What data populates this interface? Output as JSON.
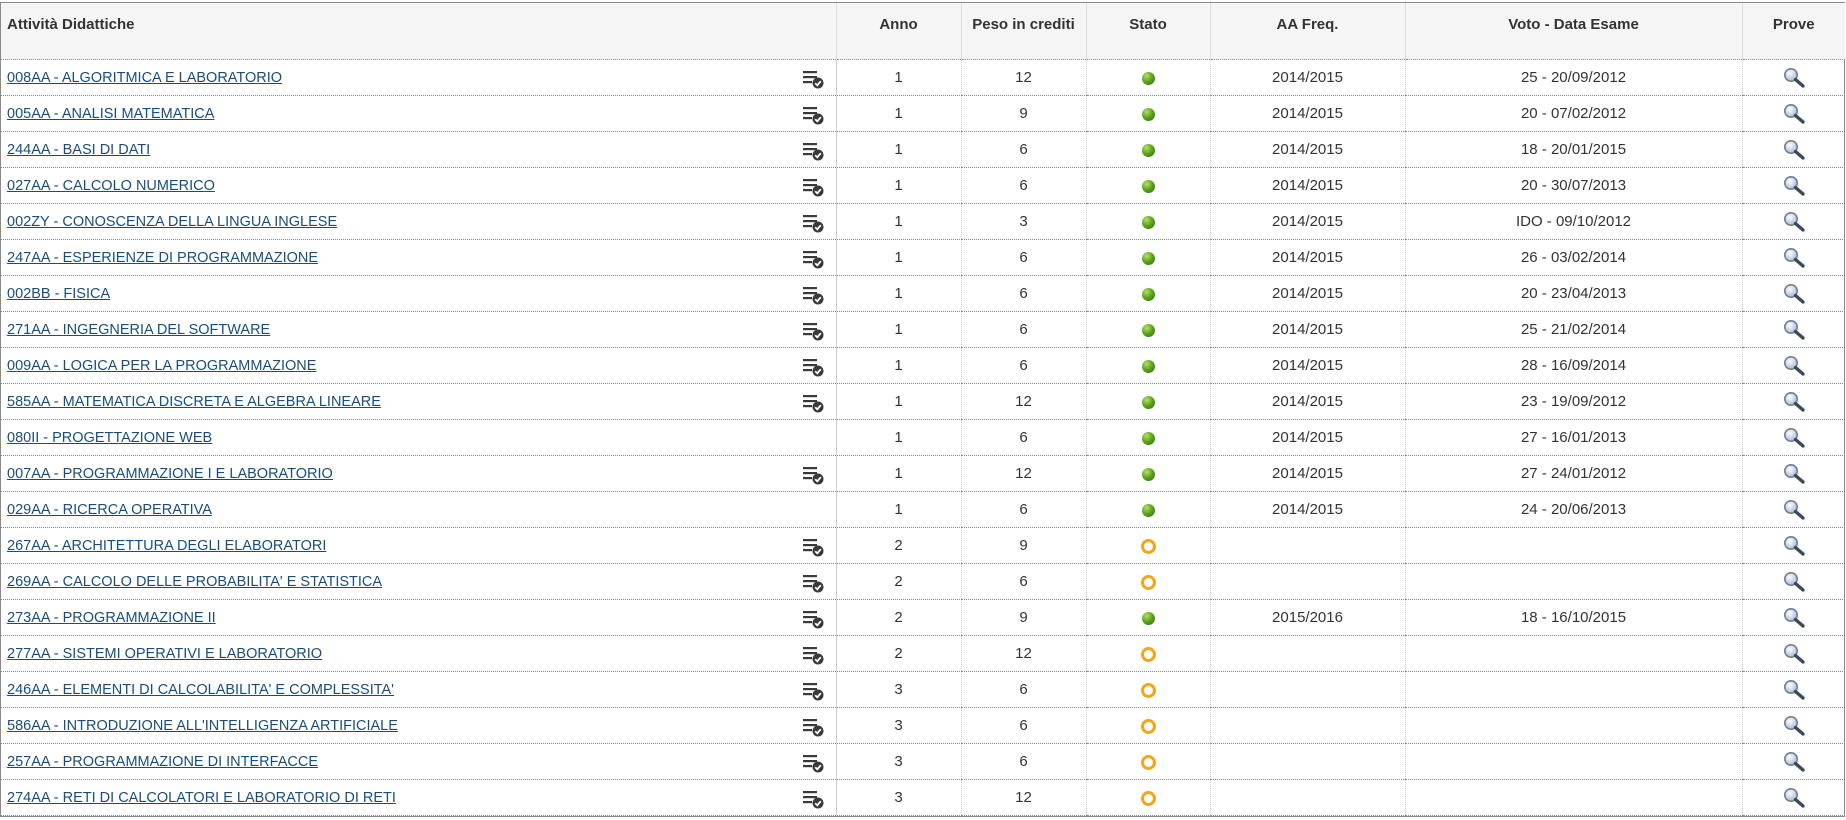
{
  "table": {
    "headers": {
      "activity": "Attività Didattiche",
      "year": "Anno",
      "credits": "Peso in crediti",
      "status": "Stato",
      "aa_freq": "AA Freq.",
      "grade_date": "Voto - Data Esame",
      "tests": "Prove"
    },
    "rows": [
      {
        "activity": "008AA - ALGORITMICA E LABORATORIO",
        "list_icon": true,
        "year": "1",
        "credits": "12",
        "status": "passed",
        "aa_freq": "2014/2015",
        "grade_date": "25 - 20/09/2012"
      },
      {
        "activity": "005AA - ANALISI MATEMATICA",
        "list_icon": true,
        "year": "1",
        "credits": "9",
        "status": "passed",
        "aa_freq": "2014/2015",
        "grade_date": "20 - 07/02/2012"
      },
      {
        "activity": "244AA - BASI DI DATI",
        "list_icon": true,
        "year": "1",
        "credits": "6",
        "status": "passed",
        "aa_freq": "2014/2015",
        "grade_date": "18 - 20/01/2015"
      },
      {
        "activity": "027AA - CALCOLO NUMERICO",
        "list_icon": true,
        "year": "1",
        "credits": "6",
        "status": "passed",
        "aa_freq": "2014/2015",
        "grade_date": "20 - 30/07/2013"
      },
      {
        "activity": "002ZY - CONOSCENZA DELLA LINGUA INGLESE",
        "list_icon": true,
        "year": "1",
        "credits": "3",
        "status": "passed",
        "aa_freq": "2014/2015",
        "grade_date": "IDO - 09/10/2012"
      },
      {
        "activity": "247AA - ESPERIENZE DI PROGRAMMAZIONE",
        "list_icon": true,
        "year": "1",
        "credits": "6",
        "status": "passed",
        "aa_freq": "2014/2015",
        "grade_date": "26 - 03/02/2014"
      },
      {
        "activity": "002BB - FISICA",
        "list_icon": true,
        "year": "1",
        "credits": "6",
        "status": "passed",
        "aa_freq": "2014/2015",
        "grade_date": "20 - 23/04/2013"
      },
      {
        "activity": "271AA - INGEGNERIA DEL SOFTWARE",
        "list_icon": true,
        "year": "1",
        "credits": "6",
        "status": "passed",
        "aa_freq": "2014/2015",
        "grade_date": "25 - 21/02/2014"
      },
      {
        "activity": "009AA - LOGICA PER LA PROGRAMMAZIONE",
        "list_icon": true,
        "year": "1",
        "credits": "6",
        "status": "passed",
        "aa_freq": "2014/2015",
        "grade_date": "28 - 16/09/2014"
      },
      {
        "activity": "585AA - MATEMATICA DISCRETA E ALGEBRA LINEARE",
        "list_icon": true,
        "year": "1",
        "credits": "12",
        "status": "passed",
        "aa_freq": "2014/2015",
        "grade_date": "23 - 19/09/2012"
      },
      {
        "activity": "080II - PROGETTAZIONE WEB",
        "list_icon": false,
        "year": "1",
        "credits": "6",
        "status": "passed",
        "aa_freq": "2014/2015",
        "grade_date": "27 - 16/01/2013"
      },
      {
        "activity": "007AA - PROGRAMMAZIONE I E LABORATORIO",
        "list_icon": true,
        "year": "1",
        "credits": "12",
        "status": "passed",
        "aa_freq": "2014/2015",
        "grade_date": "27 - 24/01/2012"
      },
      {
        "activity": "029AA - RICERCA OPERATIVA",
        "list_icon": false,
        "year": "1",
        "credits": "6",
        "status": "passed",
        "aa_freq": "2014/2015",
        "grade_date": "24 - 20/06/2013"
      },
      {
        "activity": "267AA - ARCHITETTURA DEGLI ELABORATORI",
        "list_icon": true,
        "year": "2",
        "credits": "9",
        "status": "pending",
        "aa_freq": "",
        "grade_date": ""
      },
      {
        "activity": "269AA - CALCOLO DELLE PROBABILITA' E STATISTICA",
        "list_icon": true,
        "year": "2",
        "credits": "6",
        "status": "pending",
        "aa_freq": "",
        "grade_date": ""
      },
      {
        "activity": "273AA - PROGRAMMAZIONE II",
        "list_icon": true,
        "year": "2",
        "credits": "9",
        "status": "passed",
        "aa_freq": "2015/2016",
        "grade_date": "18 - 16/10/2015"
      },
      {
        "activity": "277AA - SISTEMI OPERATIVI E LABORATORIO",
        "list_icon": true,
        "year": "2",
        "credits": "12",
        "status": "pending",
        "aa_freq": "",
        "grade_date": ""
      },
      {
        "activity": "246AA - ELEMENTI DI CALCOLABILITA' E COMPLESSITA'",
        "list_icon": true,
        "year": "3",
        "credits": "6",
        "status": "pending",
        "aa_freq": "",
        "grade_date": ""
      },
      {
        "activity": "586AA - INTRODUZIONE ALL'INTELLIGENZA ARTIFICIALE",
        "list_icon": true,
        "year": "3",
        "credits": "6",
        "status": "pending",
        "aa_freq": "",
        "grade_date": ""
      },
      {
        "activity": "257AA - PROGRAMMAZIONE DI INTERFACCE",
        "list_icon": true,
        "year": "3",
        "credits": "6",
        "status": "pending",
        "aa_freq": "",
        "grade_date": ""
      },
      {
        "activity": "274AA - RETI DI CALCOLATORI E LABORATORIO DI RETI",
        "list_icon": true,
        "year": "3",
        "credits": "12",
        "status": "pending",
        "aa_freq": "",
        "grade_date": ""
      }
    ]
  },
  "colors": {
    "link": "#1a4d7a",
    "status_passed": "#5ea61d",
    "status_pending": "#f3a51c",
    "header_bg": "#f5f5f5"
  },
  "icons": {
    "list": "list-check-icon",
    "passed": "green-dot-icon",
    "pending": "orange-ring-icon",
    "tests": "magnifier-icon"
  }
}
